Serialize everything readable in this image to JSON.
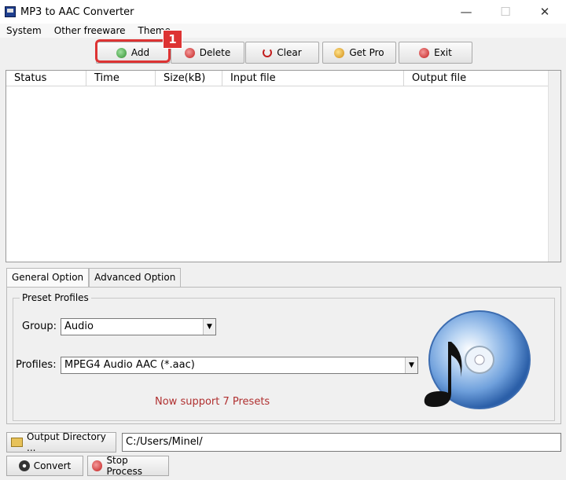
{
  "window": {
    "title": "MP3 to AAC Converter",
    "controls": [
      "—",
      "☐",
      "✕"
    ]
  },
  "menu": {
    "items": [
      "System",
      "Other freeware",
      "Theme"
    ]
  },
  "toolbar": {
    "buttons": [
      {
        "label": "Add",
        "icon": "add-icon",
        "color": "#3a9a3a"
      },
      {
        "label": "Delete",
        "icon": "delete-icon",
        "color": "#cc2222"
      },
      {
        "label": "Clear",
        "icon": "clear-icon",
        "color": "#cc2222"
      },
      {
        "label": "Get Pro",
        "icon": "get-pro-icon",
        "color": "#e0a020"
      },
      {
        "label": "Exit",
        "icon": "exit-icon",
        "color": "#cc2222"
      }
    ]
  },
  "annotation": {
    "badge": "1",
    "color": "#dd3333"
  },
  "file_list": {
    "columns": [
      "Status",
      "Time",
      "Size(kB)",
      "Input file",
      "Output file"
    ],
    "rows": []
  },
  "tabs": {
    "general": "General Option",
    "advanced": "Advanced Option"
  },
  "preset": {
    "legend": "Preset Profiles",
    "group_label": "Group:",
    "group_value": "Audio",
    "profiles_label": "Profiles:",
    "profiles_value": "MPEG4 Audio AAC (*.aac)",
    "support_text": "Now support 7 Presets"
  },
  "output": {
    "button_label": "Output Directory ...",
    "path": "C:/Users/Minel/"
  },
  "actions": {
    "convert_label": "Convert",
    "stop_label": "Stop Process"
  }
}
